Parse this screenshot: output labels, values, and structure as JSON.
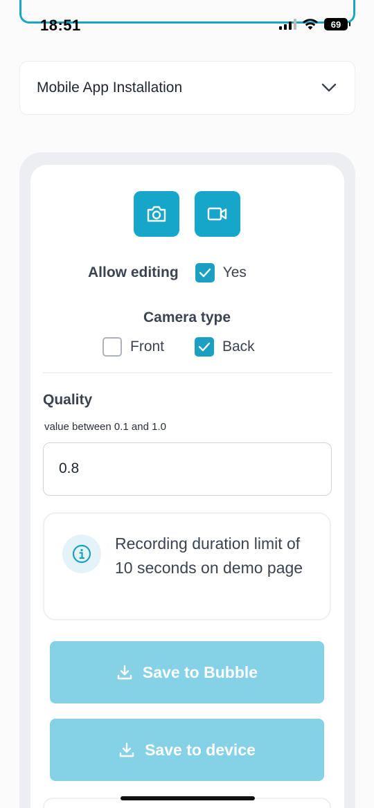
{
  "status_bar": {
    "time": "18:51",
    "battery": "69"
  },
  "dropdown": {
    "label": "Mobile App Installation"
  },
  "media_buttons": {
    "photo_icon": "camera-icon",
    "video_icon": "video-icon"
  },
  "allow_editing": {
    "label": "Allow editing",
    "option": "Yes",
    "checked": true
  },
  "camera_type": {
    "label": "Camera type",
    "options": [
      {
        "label": "Front",
        "checked": false
      },
      {
        "label": "Back",
        "checked": true
      }
    ]
  },
  "quality": {
    "title": "Quality",
    "hint": "value between 0.1 and 1.0",
    "value": "0.8"
  },
  "info": {
    "text": "Recording duration limit of 10 seconds on demo page"
  },
  "actions": {
    "save_bubble": "Save to Bubble",
    "save_device": "Save to device"
  },
  "colors": {
    "accent": "#16a6c9",
    "button_disabled": "#85d1e6"
  }
}
